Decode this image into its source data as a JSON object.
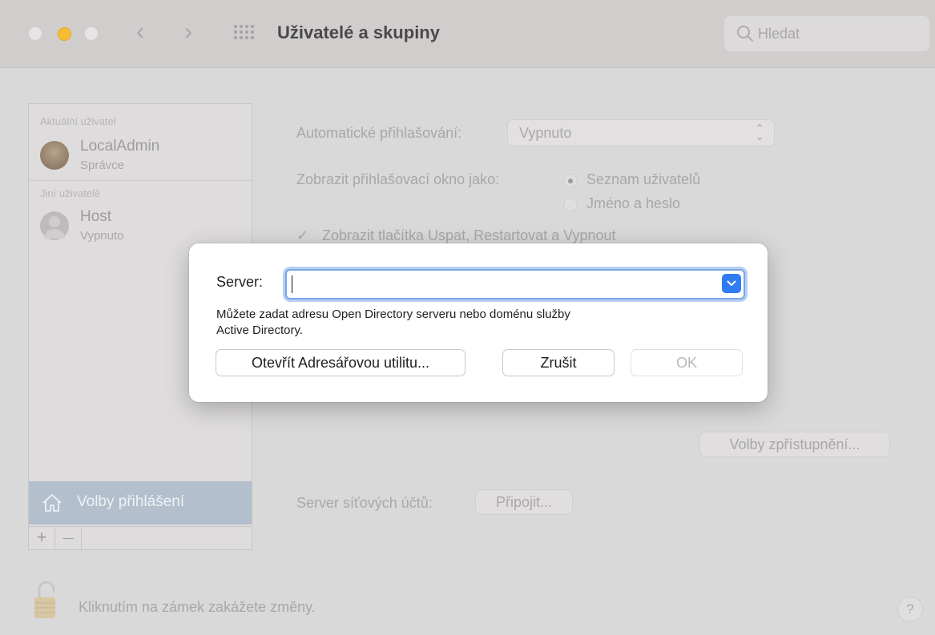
{
  "window": {
    "title": "Uživatelé a skupiny"
  },
  "search": {
    "placeholder": "Hledat"
  },
  "sidebar": {
    "section_current": "Aktuální uživatel",
    "section_other": "Jiní uživatelé",
    "users": [
      {
        "name": "LocalAdmin",
        "role": "Správce"
      },
      {
        "name": "Host",
        "role": "Vypnuto"
      }
    ],
    "login_options": "Volby přihlášení",
    "add": "+",
    "remove": "—"
  },
  "main": {
    "auto_login_label": "Automatické přihlašování:",
    "auto_login_value": "Vypnuto",
    "display_as_label": "Zobrazit přihlašovací okno jako:",
    "display_options": [
      "Seznam uživatelů",
      "Jméno a heslo"
    ],
    "show_buttons_check": "✓",
    "show_buttons_label": "Zobrazit tlačítka Uspat, Restartovat a Vypnout",
    "accessibility_button": "Volby zpřístupnění...",
    "network_server_label": "Server síťových účtů:",
    "connect_button": "Připojit..."
  },
  "footer": {
    "lock_text": "Kliknutím na zámek zakážete změny.",
    "help": "?"
  },
  "dialog": {
    "server_label": "Server:",
    "server_value": "",
    "hint_line1": "Můžete zadat adresu Open Directory serveru nebo doménu služby",
    "hint_line2": "Active Directory.",
    "open_utility_button": "Otevřít Adresářovou utilitu...",
    "cancel_button": "Zrušit",
    "ok_button": "OK"
  },
  "colors": {
    "accent": "#2f7cf6",
    "focus_ring": "#b6cff3",
    "traffic_min": "#f5bd32",
    "sidebar_selected": "#b3bfcc"
  }
}
